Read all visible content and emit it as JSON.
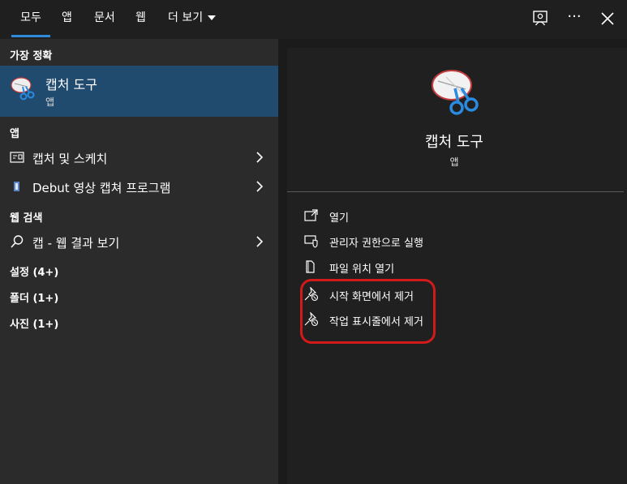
{
  "tabs": {
    "all": "모두",
    "apps": "앱",
    "documents": "문서",
    "web": "웹",
    "more": "더 보기"
  },
  "top_icons": {
    "feedback": "feedback-icon",
    "more": "···",
    "close": "close-icon"
  },
  "best_match": {
    "heading": "가장 정확",
    "name": "캡처 도구",
    "type": "앱"
  },
  "apps_section": {
    "heading": "앱",
    "items": [
      {
        "label": "캡처 및 스케치",
        "icon": "snip-sketch-icon"
      },
      {
        "label": "Debut 영상 캡쳐 프로그램",
        "icon": "debut-icon"
      }
    ]
  },
  "web_section": {
    "heading": "웹 검색",
    "item": {
      "label": "캡 - 웹 결과 보기",
      "icon": "search-icon"
    }
  },
  "categories": {
    "settings": "설정 (4+)",
    "folders": "폴더 (1+)",
    "photos": "사진 (1+)"
  },
  "detail": {
    "title": "캡처 도구",
    "subtitle": "앱",
    "actions": [
      {
        "label": "열기",
        "icon": "open-icon"
      },
      {
        "label": "관리자 권한으로 실행",
        "icon": "admin-shield-icon"
      },
      {
        "label": "파일 위치 열기",
        "icon": "file-location-icon"
      },
      {
        "label": "시작 화면에서 제거",
        "icon": "unpin-icon"
      },
      {
        "label": "작업 표시줄에서 제거",
        "icon": "unpin-icon"
      }
    ]
  },
  "colors": {
    "accent": "#2f8bd9",
    "selected_bg": "#204a6e",
    "highlight_ring": "#d21a1a"
  }
}
